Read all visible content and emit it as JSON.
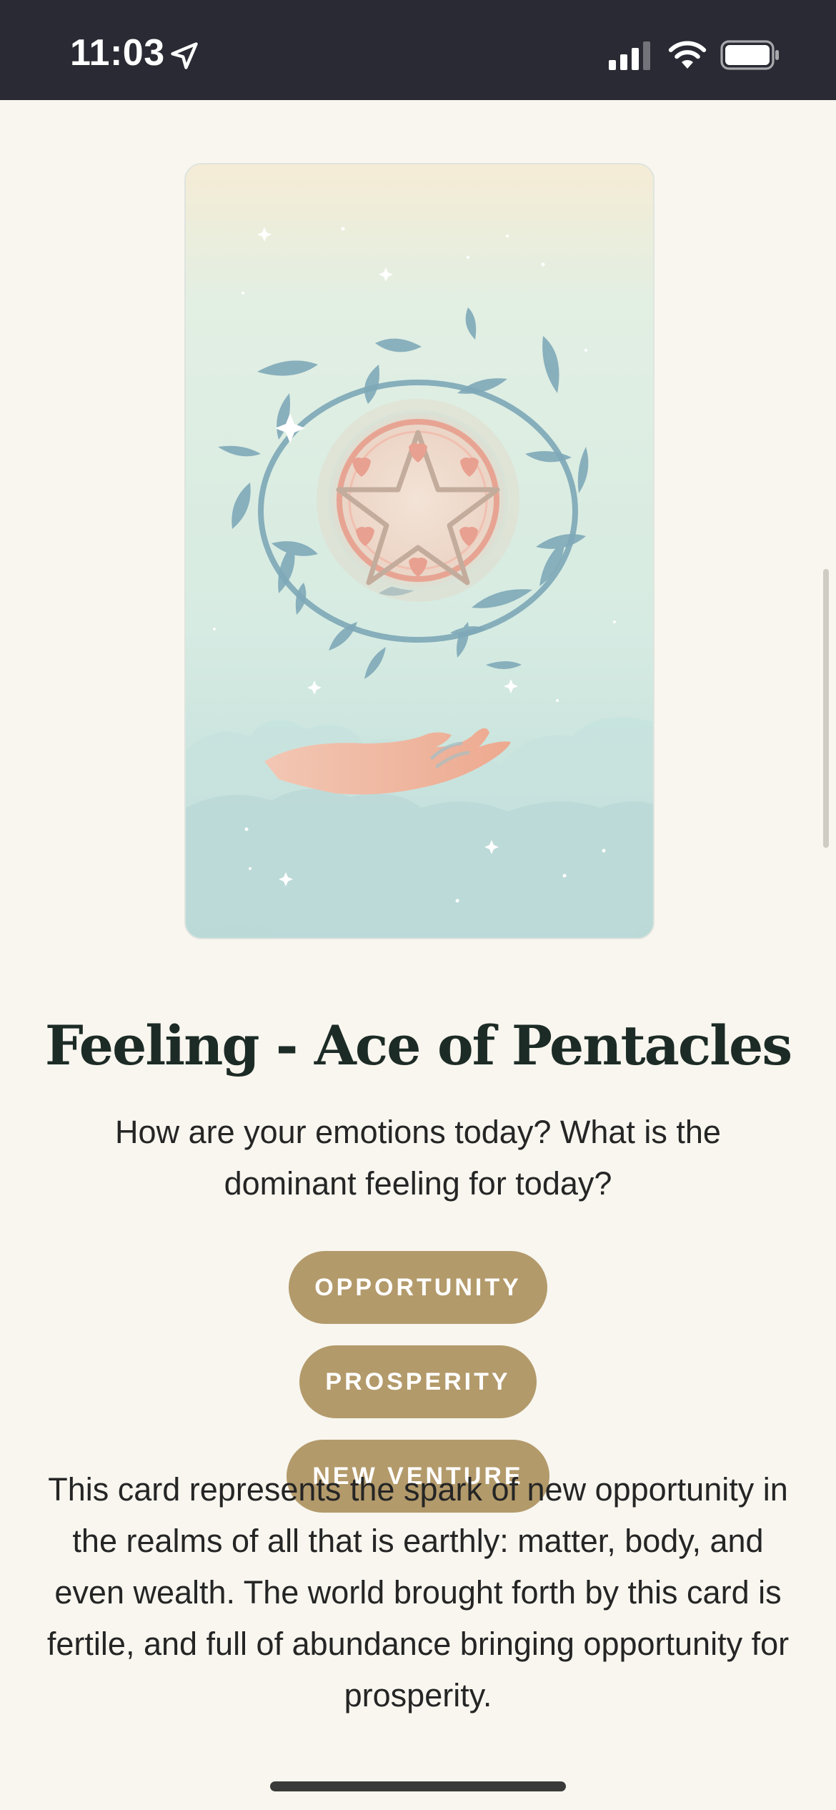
{
  "status_bar": {
    "time": "11:03",
    "icons": [
      "location-arrow-icon",
      "signal-icon",
      "wifi-icon",
      "battery-icon"
    ]
  },
  "card": {
    "name": "Ace of Pentacles",
    "illustration_icons": [
      "vine-wreath-icon",
      "pentacle-icon",
      "open-hand-icon",
      "sparkle-icon"
    ]
  },
  "title": "Feeling - Ace of Pentacles",
  "question": "How are your emotions today? What is the dominant feeling for today?",
  "tags": [
    "OPPORTUNITY",
    "PROSPERITY",
    "NEW VENTURE"
  ],
  "description": "This card represents the spark of new opportunity in the realms of all that is earthly: matter, body, and even wealth. The world brought forth by this card is fertile, and full of abundance bringing opportunity for prosperity.",
  "colors": {
    "status_bar_bg": "#292a33",
    "page_bg": "#f8f6ef",
    "tag_bg": "#b39a6b",
    "title_text": "#1d2b26"
  }
}
